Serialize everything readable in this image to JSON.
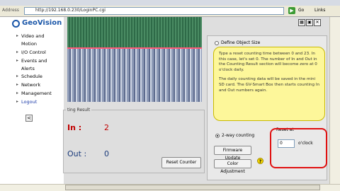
{
  "browser": {
    "address_label": "Address",
    "url": "http://192.168.0.230/LoginPC.cgi",
    "go_label": "Go",
    "links_label": "Links"
  },
  "logo": {
    "text": "GeoVision"
  },
  "sidebar": {
    "items": [
      {
        "label": "Video and"
      },
      {
        "label": "Motion"
      },
      {
        "label": "I/O Control"
      },
      {
        "label": "Events and"
      },
      {
        "label": "Alerts"
      },
      {
        "label": "Schedule"
      },
      {
        "label": "Network"
      },
      {
        "label": "Management"
      },
      {
        "label": "Logout"
      }
    ],
    "scroll_button": "<"
  },
  "counting": {
    "title": "ting Result",
    "in_label": "In :",
    "in_value": "2",
    "out_label": "Out :",
    "out_value": "0",
    "reset_button": "Reset Counter"
  },
  "settings": {
    "define_object_size": "Define Object Size",
    "two_way_counting": "2-way counting",
    "firmware_update": "Firmware Update",
    "color_adjustment": "Color Adjustment",
    "reset_at_label": "Reset at",
    "reset_hour": "0",
    "oclock": "o'clock"
  },
  "tooltip": {
    "para1": "Type a reset counting time between 0 and 23. In this case, let's set 0. The number of In and Out in the Counting Result section will become zero at 0 o'clock daily.",
    "para2": "The daily counting data will be saved in the mini SD card. The GV-Smart Box then starts counting In and Out numbers again."
  },
  "colors": {
    "in_color": "#c00000",
    "out_color": "#1a3a7a",
    "highlight": "#e01010",
    "tooltip_bg": "#fdf79a"
  }
}
